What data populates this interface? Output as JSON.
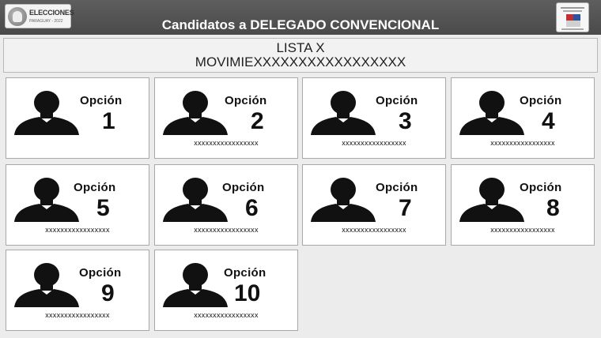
{
  "header": {
    "title": "Candidatos a DELEGADO CONVENCIONAL",
    "logo_left_line1": "ELECCIONES",
    "logo_left_line2": "PARAGUAY - 2022"
  },
  "list": {
    "line1": "LISTA X",
    "line2": "MOVIMIEXXXXXXXXXXXXXXXXX"
  },
  "option_label": "Opción",
  "candidates": [
    {
      "number": "1",
      "name": ""
    },
    {
      "number": "2",
      "name": "xxxxxxxxxxxxxxxxx"
    },
    {
      "number": "3",
      "name": "xxxxxxxxxxxxxxxxx"
    },
    {
      "number": "4",
      "name": "xxxxxxxxxxxxxxxxx"
    },
    {
      "number": "5",
      "name": "xxxxxxxxxxxxxxxxx"
    },
    {
      "number": "6",
      "name": "xxxxxxxxxxxxxxxxx"
    },
    {
      "number": "7",
      "name": "xxxxxxxxxxxxxxxxx"
    },
    {
      "number": "8",
      "name": "xxxxxxxxxxxxxxxxx"
    },
    {
      "number": "9",
      "name": "xxxxxxxxxxxxxxxxx"
    },
    {
      "number": "10",
      "name": "xxxxxxxxxxxxxxxxx"
    }
  ]
}
